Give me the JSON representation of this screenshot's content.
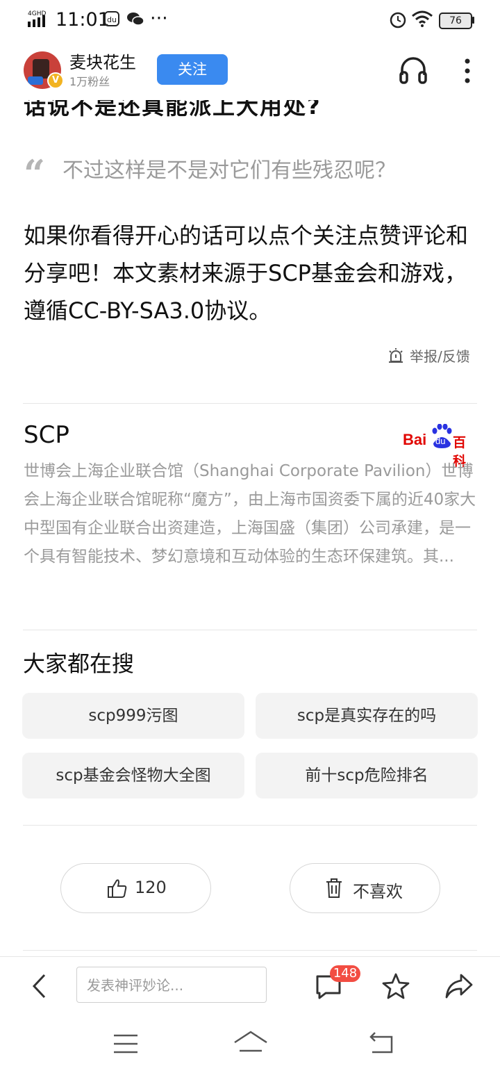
{
  "status_bar": {
    "network": "4GHD",
    "time": "11:01",
    "battery": "76"
  },
  "header": {
    "author": "麦块花生",
    "fans": "1万粉丝",
    "follow_label": "关注",
    "verified_badge": "V"
  },
  "article": {
    "partial_heading": "话说不是还真能派上大用处?",
    "quote": "不过这样是不是对它们有些残忍呢？",
    "paragraph": "如果你看得开心的话可以点个关注点赞评论和分享吧！本文素材来源于SCP基金会和游戏，遵循CC-BY-SA3.0协议。",
    "report_label": "举报/反馈"
  },
  "baike": {
    "title": "SCP",
    "logo_bai": "Bai",
    "logo_du": "du",
    "logo_baike": "百科",
    "description": "世博会上海企业联合馆（Shanghai Corporate Pavilion）世博会上海企业联合馆昵称“魔方”，由上海市国资委下属的近40家大中型国有企业联合出资建造，上海国盛（集团）公司承建，是一个具有智能技术、梦幻意境和互动体验的生态环保建筑。其..."
  },
  "search": {
    "title": "大家都在搜",
    "items": [
      {
        "label": "scp999污图"
      },
      {
        "label": "scp是真实存在的吗"
      },
      {
        "label": "scp基金会怪物大全图"
      },
      {
        "label": "前十scp危险排名"
      }
    ]
  },
  "actions": {
    "like_count": "120",
    "dislike_label": "不喜欢"
  },
  "bottom_bar": {
    "comment_placeholder": "发表神评妙论...",
    "comment_count": "148"
  },
  "colors": {
    "accent": "#3a8af0",
    "badge_red": "#f24d42",
    "baike_red": "#e10602",
    "baike_blue": "#2932e1"
  }
}
